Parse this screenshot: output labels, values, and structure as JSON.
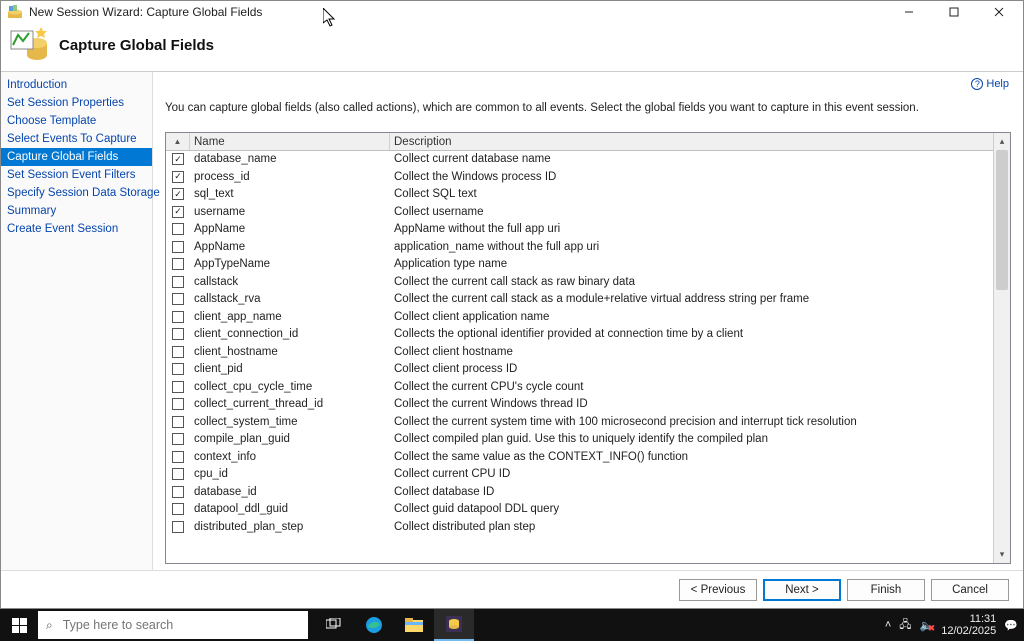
{
  "window": {
    "title": "New Session Wizard: Capture Global Fields",
    "heading": "Capture Global Fields",
    "helpLabel": "Help",
    "description": "You can capture global fields (also called actions), which are common to all events. Select the global fields you want to capture in this event session."
  },
  "sidebar": {
    "items": [
      {
        "label": "Introduction",
        "selected": false
      },
      {
        "label": "Set Session Properties",
        "selected": false
      },
      {
        "label": "Choose Template",
        "selected": false
      },
      {
        "label": "Select Events To Capture",
        "selected": false
      },
      {
        "label": "Capture Global Fields",
        "selected": true
      },
      {
        "label": "Set Session Event Filters",
        "selected": false
      },
      {
        "label": "Specify Session Data Storage",
        "selected": false
      },
      {
        "label": "Summary",
        "selected": false
      },
      {
        "label": "Create Event Session",
        "selected": false
      }
    ]
  },
  "grid": {
    "columns": {
      "name": "Name",
      "description": "Description"
    },
    "rows": [
      {
        "checked": true,
        "name": "database_name",
        "desc": "Collect current database name"
      },
      {
        "checked": true,
        "name": "process_id",
        "desc": "Collect the Windows process ID"
      },
      {
        "checked": true,
        "name": "sql_text",
        "desc": "Collect SQL text"
      },
      {
        "checked": true,
        "name": "username",
        "desc": "Collect username"
      },
      {
        "checked": false,
        "name": "AppName",
        "desc": "AppName without the full app uri"
      },
      {
        "checked": false,
        "name": "AppName",
        "desc": "application_name without the full app uri"
      },
      {
        "checked": false,
        "name": "AppTypeName",
        "desc": "Application type name"
      },
      {
        "checked": false,
        "name": "callstack",
        "desc": "Collect the current call stack as raw binary data"
      },
      {
        "checked": false,
        "name": "callstack_rva",
        "desc": "Collect the current call stack as a module+relative virtual address string per frame"
      },
      {
        "checked": false,
        "name": "client_app_name",
        "desc": "Collect client application name"
      },
      {
        "checked": false,
        "name": "client_connection_id",
        "desc": "Collects the optional identifier provided at connection time by a client"
      },
      {
        "checked": false,
        "name": "client_hostname",
        "desc": "Collect client hostname"
      },
      {
        "checked": false,
        "name": "client_pid",
        "desc": "Collect client process ID"
      },
      {
        "checked": false,
        "name": "collect_cpu_cycle_time",
        "desc": "Collect the current CPU's cycle count"
      },
      {
        "checked": false,
        "name": "collect_current_thread_id",
        "desc": "Collect the current Windows thread ID"
      },
      {
        "checked": false,
        "name": "collect_system_time",
        "desc": "Collect the current system time with 100 microsecond precision and interrupt tick resolution"
      },
      {
        "checked": false,
        "name": "compile_plan_guid",
        "desc": "Collect compiled plan guid. Use this to uniquely identify the compiled plan"
      },
      {
        "checked": false,
        "name": "context_info",
        "desc": "Collect the same value as the CONTEXT_INFO() function"
      },
      {
        "checked": false,
        "name": "cpu_id",
        "desc": "Collect current CPU ID"
      },
      {
        "checked": false,
        "name": "database_id",
        "desc": "Collect database ID"
      },
      {
        "checked": false,
        "name": "datapool_ddl_guid",
        "desc": "Collect guid datapool DDL query"
      },
      {
        "checked": false,
        "name": "distributed_plan_step",
        "desc": "Collect distributed plan step"
      }
    ]
  },
  "footer": {
    "previous": "< Previous",
    "next": "Next >",
    "finish": "Finish",
    "cancel": "Cancel"
  },
  "taskbar": {
    "searchPlaceholder": "Type here to search",
    "time": "11:31",
    "date": "12/02/2025"
  }
}
